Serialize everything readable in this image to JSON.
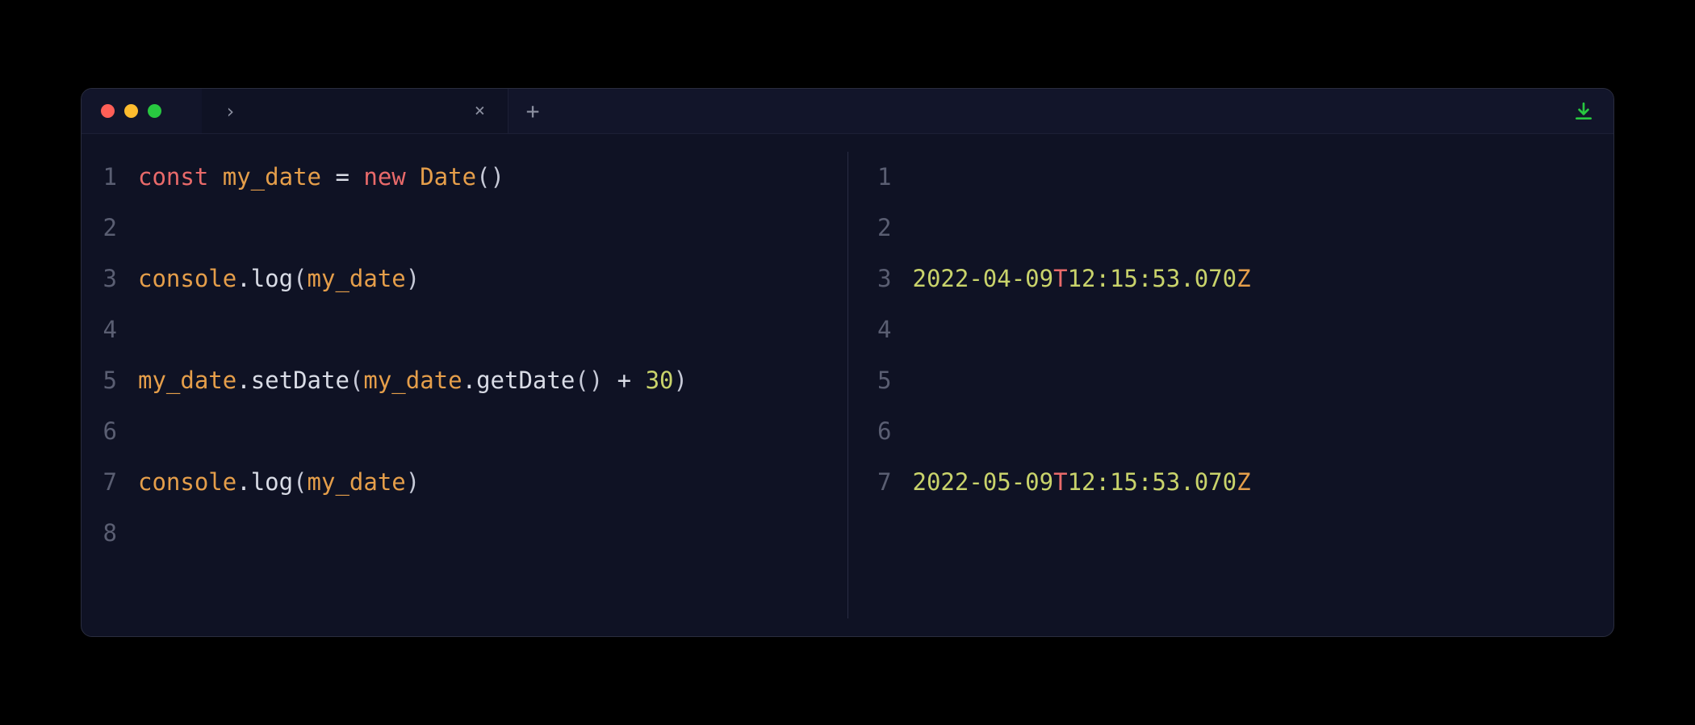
{
  "titlebar": {
    "tab_title": "›",
    "close_glyph": "×",
    "newtab_glyph": "+"
  },
  "left_pane": {
    "line_numbers": [
      "1",
      "2",
      "3",
      "4",
      "5",
      "6",
      "7",
      "8"
    ],
    "lines": {
      "l1": {
        "const": "const ",
        "var": "my_date",
        "eq": " = ",
        "new": "new ",
        "class": "Date",
        "paren": "()"
      },
      "l3": {
        "obj": "console",
        "dot": ".",
        "method": "log",
        "open": "(",
        "arg": "my_date",
        "close": ")"
      },
      "l5": {
        "obj1": "my_date",
        "dot1": ".",
        "method1": "setDate",
        "open1": "(",
        "obj2": "my_date",
        "dot2": ".",
        "method2": "getDate",
        "call2": "()",
        "plus": " + ",
        "num": "30",
        "close1": ")"
      },
      "l7": {
        "obj": "console",
        "dot": ".",
        "method": "log",
        "open": "(",
        "arg": "my_date",
        "close": ")"
      }
    }
  },
  "right_pane": {
    "line_numbers": [
      "1",
      "2",
      "3",
      "4",
      "5",
      "6",
      "7"
    ],
    "lines": {
      "l3": {
        "date": "2022-04-09",
        "t": "T",
        "time": "12:15:53.070",
        "z": "Z"
      },
      "l7": {
        "date": "2022-05-09",
        "t": "T",
        "time": "12:15:53.070",
        "z": "Z"
      }
    }
  }
}
